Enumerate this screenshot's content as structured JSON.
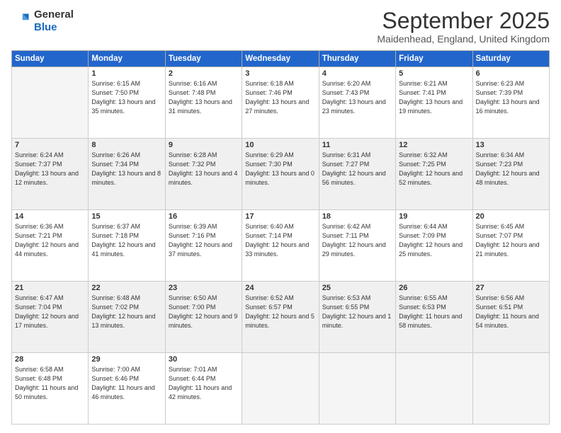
{
  "logo": {
    "general": "General",
    "blue": "Blue"
  },
  "title": "September 2025",
  "location": "Maidenhead, England, United Kingdom",
  "days_of_week": [
    "Sunday",
    "Monday",
    "Tuesday",
    "Wednesday",
    "Thursday",
    "Friday",
    "Saturday"
  ],
  "weeks": [
    [
      {
        "day": "",
        "empty": true
      },
      {
        "day": "1",
        "sunrise": "Sunrise: 6:15 AM",
        "sunset": "Sunset: 7:50 PM",
        "daylight": "Daylight: 13 hours and 35 minutes."
      },
      {
        "day": "2",
        "sunrise": "Sunrise: 6:16 AM",
        "sunset": "Sunset: 7:48 PM",
        "daylight": "Daylight: 13 hours and 31 minutes."
      },
      {
        "day": "3",
        "sunrise": "Sunrise: 6:18 AM",
        "sunset": "Sunset: 7:46 PM",
        "daylight": "Daylight: 13 hours and 27 minutes."
      },
      {
        "day": "4",
        "sunrise": "Sunrise: 6:20 AM",
        "sunset": "Sunset: 7:43 PM",
        "daylight": "Daylight: 13 hours and 23 minutes."
      },
      {
        "day": "5",
        "sunrise": "Sunrise: 6:21 AM",
        "sunset": "Sunset: 7:41 PM",
        "daylight": "Daylight: 13 hours and 19 minutes."
      },
      {
        "day": "6",
        "sunrise": "Sunrise: 6:23 AM",
        "sunset": "Sunset: 7:39 PM",
        "daylight": "Daylight: 13 hours and 16 minutes."
      }
    ],
    [
      {
        "day": "7",
        "sunrise": "Sunrise: 6:24 AM",
        "sunset": "Sunset: 7:37 PM",
        "daylight": "Daylight: 13 hours and 12 minutes."
      },
      {
        "day": "8",
        "sunrise": "Sunrise: 6:26 AM",
        "sunset": "Sunset: 7:34 PM",
        "daylight": "Daylight: 13 hours and 8 minutes."
      },
      {
        "day": "9",
        "sunrise": "Sunrise: 6:28 AM",
        "sunset": "Sunset: 7:32 PM",
        "daylight": "Daylight: 13 hours and 4 minutes."
      },
      {
        "day": "10",
        "sunrise": "Sunrise: 6:29 AM",
        "sunset": "Sunset: 7:30 PM",
        "daylight": "Daylight: 13 hours and 0 minutes."
      },
      {
        "day": "11",
        "sunrise": "Sunrise: 6:31 AM",
        "sunset": "Sunset: 7:27 PM",
        "daylight": "Daylight: 12 hours and 56 minutes."
      },
      {
        "day": "12",
        "sunrise": "Sunrise: 6:32 AM",
        "sunset": "Sunset: 7:25 PM",
        "daylight": "Daylight: 12 hours and 52 minutes."
      },
      {
        "day": "13",
        "sunrise": "Sunrise: 6:34 AM",
        "sunset": "Sunset: 7:23 PM",
        "daylight": "Daylight: 12 hours and 48 minutes."
      }
    ],
    [
      {
        "day": "14",
        "sunrise": "Sunrise: 6:36 AM",
        "sunset": "Sunset: 7:21 PM",
        "daylight": "Daylight: 12 hours and 44 minutes."
      },
      {
        "day": "15",
        "sunrise": "Sunrise: 6:37 AM",
        "sunset": "Sunset: 7:18 PM",
        "daylight": "Daylight: 12 hours and 41 minutes."
      },
      {
        "day": "16",
        "sunrise": "Sunrise: 6:39 AM",
        "sunset": "Sunset: 7:16 PM",
        "daylight": "Daylight: 12 hours and 37 minutes."
      },
      {
        "day": "17",
        "sunrise": "Sunrise: 6:40 AM",
        "sunset": "Sunset: 7:14 PM",
        "daylight": "Daylight: 12 hours and 33 minutes."
      },
      {
        "day": "18",
        "sunrise": "Sunrise: 6:42 AM",
        "sunset": "Sunset: 7:11 PM",
        "daylight": "Daylight: 12 hours and 29 minutes."
      },
      {
        "day": "19",
        "sunrise": "Sunrise: 6:44 AM",
        "sunset": "Sunset: 7:09 PM",
        "daylight": "Daylight: 12 hours and 25 minutes."
      },
      {
        "day": "20",
        "sunrise": "Sunrise: 6:45 AM",
        "sunset": "Sunset: 7:07 PM",
        "daylight": "Daylight: 12 hours and 21 minutes."
      }
    ],
    [
      {
        "day": "21",
        "sunrise": "Sunrise: 6:47 AM",
        "sunset": "Sunset: 7:04 PM",
        "daylight": "Daylight: 12 hours and 17 minutes."
      },
      {
        "day": "22",
        "sunrise": "Sunrise: 6:48 AM",
        "sunset": "Sunset: 7:02 PM",
        "daylight": "Daylight: 12 hours and 13 minutes."
      },
      {
        "day": "23",
        "sunrise": "Sunrise: 6:50 AM",
        "sunset": "Sunset: 7:00 PM",
        "daylight": "Daylight: 12 hours and 9 minutes."
      },
      {
        "day": "24",
        "sunrise": "Sunrise: 6:52 AM",
        "sunset": "Sunset: 6:57 PM",
        "daylight": "Daylight: 12 hours and 5 minutes."
      },
      {
        "day": "25",
        "sunrise": "Sunrise: 6:53 AM",
        "sunset": "Sunset: 6:55 PM",
        "daylight": "Daylight: 12 hours and 1 minute."
      },
      {
        "day": "26",
        "sunrise": "Sunrise: 6:55 AM",
        "sunset": "Sunset: 6:53 PM",
        "daylight": "Daylight: 11 hours and 58 minutes."
      },
      {
        "day": "27",
        "sunrise": "Sunrise: 6:56 AM",
        "sunset": "Sunset: 6:51 PM",
        "daylight": "Daylight: 11 hours and 54 minutes."
      }
    ],
    [
      {
        "day": "28",
        "sunrise": "Sunrise: 6:58 AM",
        "sunset": "Sunset: 6:48 PM",
        "daylight": "Daylight: 11 hours and 50 minutes."
      },
      {
        "day": "29",
        "sunrise": "Sunrise: 7:00 AM",
        "sunset": "Sunset: 6:46 PM",
        "daylight": "Daylight: 11 hours and 46 minutes."
      },
      {
        "day": "30",
        "sunrise": "Sunrise: 7:01 AM",
        "sunset": "Sunset: 6:44 PM",
        "daylight": "Daylight: 11 hours and 42 minutes."
      },
      {
        "day": "",
        "empty": true
      },
      {
        "day": "",
        "empty": true
      },
      {
        "day": "",
        "empty": true
      },
      {
        "day": "",
        "empty": true
      }
    ]
  ]
}
